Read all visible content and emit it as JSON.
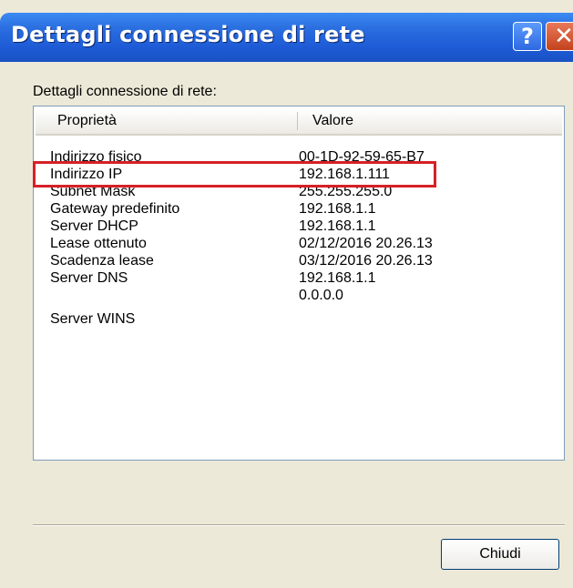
{
  "window": {
    "title": "Dettagli connessione di rete",
    "help_label": "?",
    "close_label": "✕"
  },
  "dialog": {
    "label": "Dettagli connessione di rete:",
    "columns": {
      "property": "Proprietà",
      "value": "Valore"
    },
    "rows": [
      {
        "property": "Indirizzo fisico",
        "value": "00-1D-92-59-65-B7"
      },
      {
        "property": "Indirizzo IP",
        "value": "192.168.1.111",
        "highlighted": true
      },
      {
        "property": "Subnet Mask",
        "value": "255.255.255.0"
      },
      {
        "property": "Gateway predefinito",
        "value": "192.168.1.1"
      },
      {
        "property": "Server DHCP",
        "value": "192.168.1.1"
      },
      {
        "property": "Lease ottenuto",
        "value": "02/12/2016 20.26.13"
      },
      {
        "property": "Scadenza lease",
        "value": "03/12/2016 20.26.13"
      },
      {
        "property": "Server DNS",
        "value": "192.168.1.1"
      },
      {
        "property": "",
        "value": "0.0.0.0"
      },
      {
        "property": "Server WINS",
        "value": ""
      }
    ],
    "close_button_label": "Chiudi"
  },
  "colors": {
    "titlebar": "#1E5BD6",
    "highlight_border": "#D62027",
    "dialog_bg": "#ECE9D8"
  }
}
